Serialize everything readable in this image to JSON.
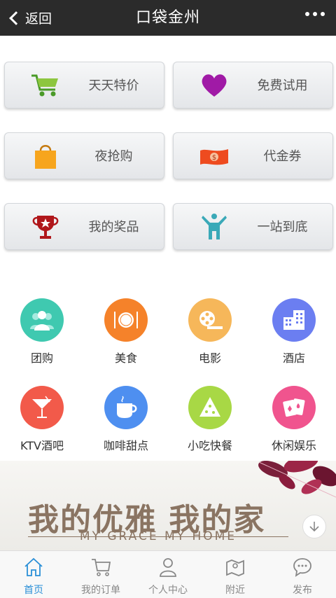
{
  "header": {
    "back_label": "返回",
    "title": "口袋金州"
  },
  "buttons": [
    {
      "label": "天天特价",
      "icon": "shopping-cart-icon"
    },
    {
      "label": "免费试用",
      "icon": "heart-icon"
    },
    {
      "label": "夜抢购",
      "icon": "shopping-bag-icon"
    },
    {
      "label": "代金券",
      "icon": "money-icon"
    },
    {
      "label": "我的奖品",
      "icon": "trophy-icon"
    },
    {
      "label": "一站到底",
      "icon": "person-icon"
    }
  ],
  "categories": [
    {
      "label": "团购",
      "color": "#3fc9b0",
      "icon": "group-icon"
    },
    {
      "label": "美食",
      "color": "#f5822a",
      "icon": "plate-icon"
    },
    {
      "label": "电影",
      "color": "#f6b75a",
      "icon": "film-reel-icon"
    },
    {
      "label": "酒店",
      "color": "#6b7ef1",
      "icon": "building-icon"
    },
    {
      "label": "KTV酒吧",
      "color": "#f25a4a",
      "icon": "cocktail-icon"
    },
    {
      "label": "咖啡甜点",
      "color": "#4e8ff0",
      "icon": "coffee-cup-icon"
    },
    {
      "label": "小吃快餐",
      "color": "#a8d845",
      "icon": "pizza-icon"
    },
    {
      "label": "休闲娱乐",
      "color": "#f0548e",
      "icon": "playing-cards-icon"
    }
  ],
  "banner": {
    "headline": "我的优雅 我的家",
    "tagline": "MY GRACE MY HOME"
  },
  "tabbar": [
    {
      "label": "首页",
      "icon": "home-icon",
      "active": true
    },
    {
      "label": "我的订单",
      "icon": "cart-icon",
      "active": false
    },
    {
      "label": "个人中心",
      "icon": "user-icon",
      "active": false
    },
    {
      "label": "附近",
      "icon": "map-icon",
      "active": false
    },
    {
      "label": "发布",
      "icon": "chat-bubble-icon",
      "active": false
    }
  ],
  "colors": {
    "accent": "#2a8fd7",
    "topbar": "#2b2b2b"
  }
}
